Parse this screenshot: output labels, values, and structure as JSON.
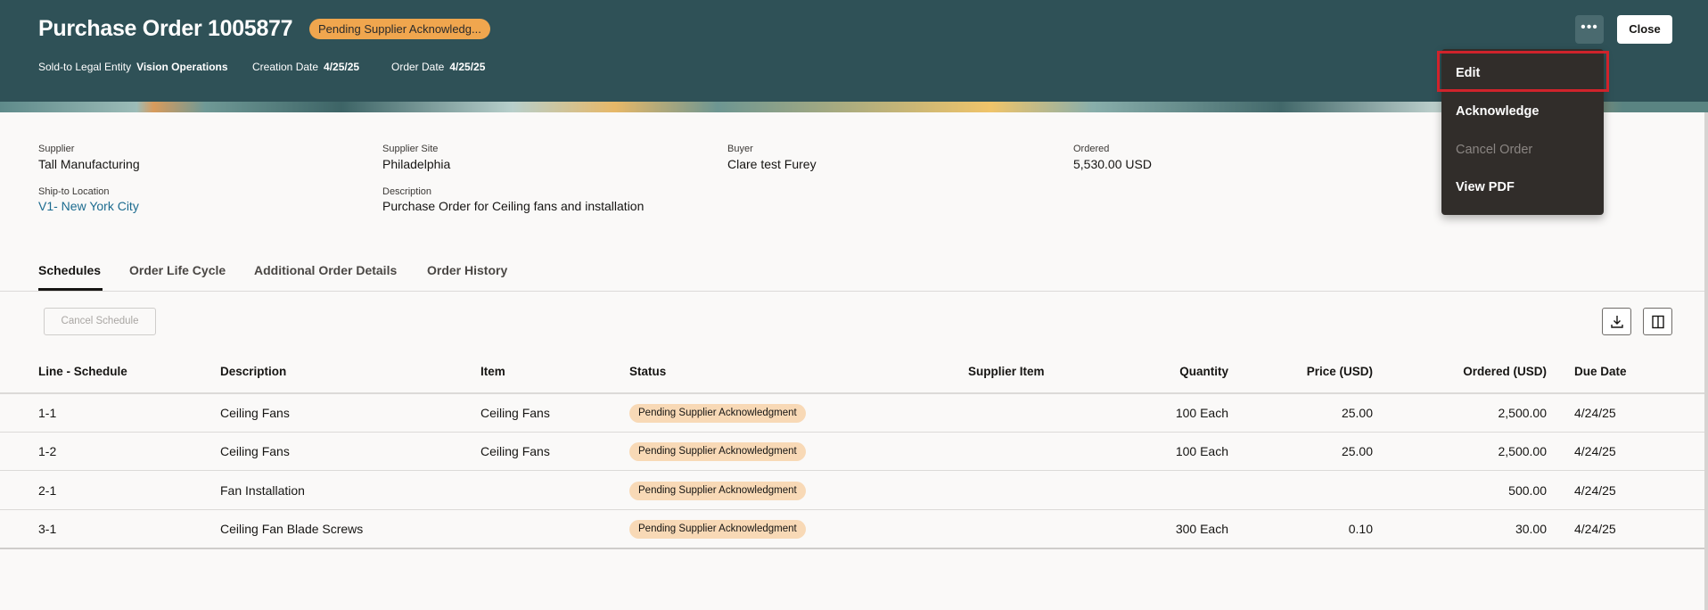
{
  "header": {
    "title": "Purchase Order 1005877",
    "status_badge": "Pending Supplier Acknowledg...",
    "sold_to_label": "Sold-to Legal Entity",
    "sold_to_value": "Vision Operations",
    "creation_date_label": "Creation Date",
    "creation_date_value": "4/25/25",
    "order_date_label": "Order Date",
    "order_date_value": "4/25/25",
    "more_label": "•••",
    "close_label": "Close"
  },
  "menu": {
    "items": [
      {
        "label": "Edit"
      },
      {
        "label": "Acknowledge"
      },
      {
        "label": "Cancel Order"
      },
      {
        "label": "View PDF"
      }
    ]
  },
  "details": {
    "supplier_label": "Supplier",
    "supplier": "Tall Manufacturing",
    "supplier_site_label": "Supplier Site",
    "supplier_site": "Philadelphia",
    "buyer_label": "Buyer",
    "buyer": "Clare test Furey",
    "ordered_label": "Ordered",
    "ordered": "5,530.00 USD",
    "ship_to_label": "Ship-to Location",
    "ship_to": "V1- New York City",
    "description_label": "Description",
    "description": "Purchase Order for Ceiling fans and installation"
  },
  "tabs": [
    {
      "label": "Schedules"
    },
    {
      "label": "Order Life Cycle"
    },
    {
      "label": "Additional Order Details"
    },
    {
      "label": "Order History"
    }
  ],
  "toolbar": {
    "cancel_schedule": "Cancel Schedule"
  },
  "table": {
    "headers": {
      "line": "Line - Schedule",
      "description": "Description",
      "item": "Item",
      "status": "Status",
      "supplier_item": "Supplier Item",
      "quantity": "Quantity",
      "price": "Price (USD)",
      "ordered": "Ordered (USD)",
      "due_date": "Due Date"
    },
    "rows": [
      {
        "line": "1-1",
        "description": "Ceiling Fans",
        "item": "Ceiling Fans",
        "status": "Pending Supplier Acknowledgment",
        "supplier_item": "",
        "quantity": "100 Each",
        "price": "25.00",
        "ordered": "2,500.00",
        "due_date": "4/24/25"
      },
      {
        "line": "1-2",
        "description": "Ceiling Fans",
        "item": "Ceiling Fans",
        "status": "Pending Supplier Acknowledgment",
        "supplier_item": "",
        "quantity": "100 Each",
        "price": "25.00",
        "ordered": "2,500.00",
        "due_date": "4/24/25"
      },
      {
        "line": "2-1",
        "description": "Fan Installation",
        "item": "",
        "status": "Pending Supplier Acknowledgment",
        "supplier_item": "",
        "quantity": "",
        "price": "",
        "ordered": "500.00",
        "due_date": "4/24/25"
      },
      {
        "line": "3-1",
        "description": "Ceiling Fan Blade Screws",
        "item": "",
        "status": "Pending Supplier Acknowledgment",
        "supplier_item": "",
        "quantity": "300 Each",
        "price": "0.10",
        "ordered": "30.00",
        "due_date": "4/24/25"
      }
    ]
  }
}
